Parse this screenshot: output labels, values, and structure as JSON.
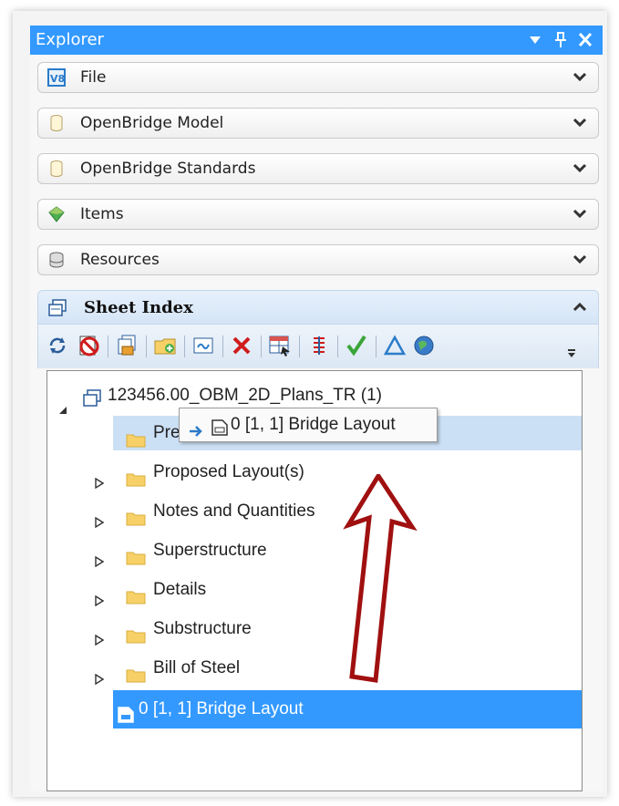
{
  "explorer": {
    "title": "Explorer",
    "controls": [
      "▼",
      "ᵖ",
      "✕"
    ]
  },
  "sections": [
    {
      "label": "File",
      "icon": "v8-icon"
    },
    {
      "label": "OpenBridge Model",
      "icon": "cylinder-icon"
    },
    {
      "label": "OpenBridge Standards",
      "icon": "cylinder-icon"
    },
    {
      "label": "Items",
      "icon": "items-icon"
    },
    {
      "label": "Resources",
      "icon": "database-icon"
    }
  ],
  "sheet_index": {
    "label": "Sheet Index",
    "toolbar_icons": [
      "refresh-icon",
      "no-icon",
      "sheet-lock-icon",
      "add-folder-icon",
      "edit-layout-icon",
      "delete-icon",
      "table-icon",
      "sort-icon",
      "check-icon",
      "delta-icon",
      "globe-icon",
      "overflow-icon"
    ]
  },
  "tree": {
    "root": "123456.00_OBM_2D_Plans_TR (1)",
    "folders": [
      "Preliminary Layout(s)",
      "Proposed Layout(s)",
      "Notes and Quantities",
      "Superstructure",
      "Details",
      "Substructure",
      "Bill of Steel"
    ],
    "selected_item": "0 [1, 1] Bridge Layout",
    "drag_preview": "0 [1, 1] Bridge Layout"
  },
  "colors": {
    "title_bar": "#3399ff",
    "selection": "#3399ff",
    "hover_row": "#cce0f5",
    "arrow": "#a01010",
    "folder": "#f7d168"
  }
}
